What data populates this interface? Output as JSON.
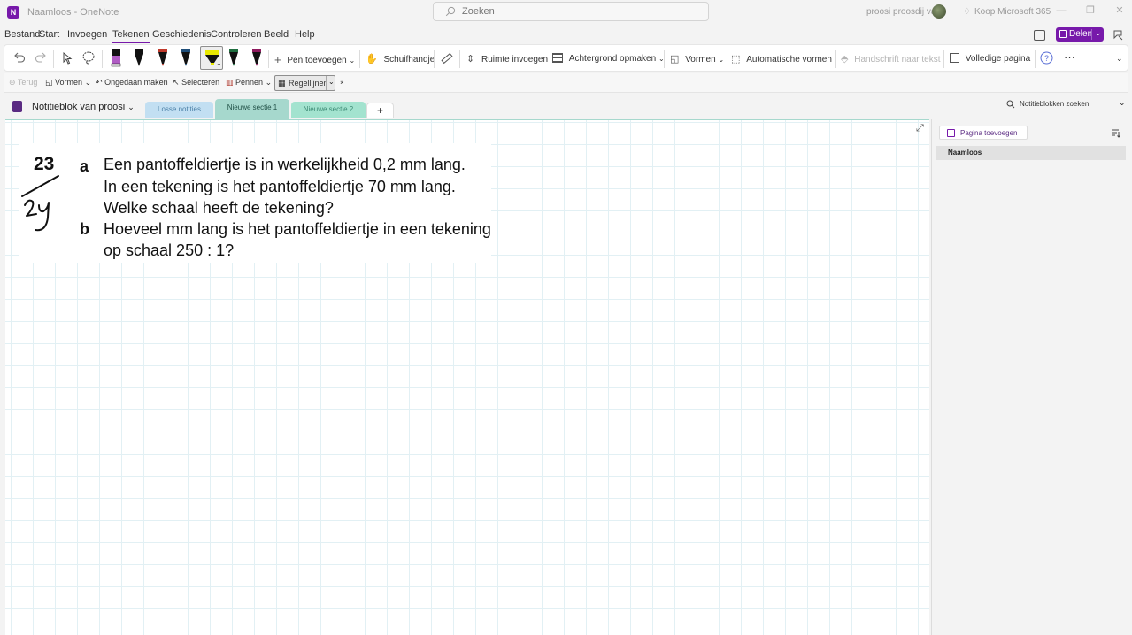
{
  "window": {
    "title": "Naamloos - OneNote",
    "search_placeholder": "Zoeken",
    "user_name": "proosi proosdij van",
    "buy_label": "Koop Microsoft 365",
    "controls": {
      "minimize": "—",
      "restore": "❐",
      "close": "✕"
    }
  },
  "menu": {
    "items": [
      "Bestand",
      "Start",
      "Invoegen",
      "Tekenen",
      "Geschiedenis",
      "Controleren",
      "Beeld",
      "Help"
    ],
    "active": "Tekenen",
    "share_label": "Delen"
  },
  "ribbon": {
    "pen_colors": [
      "#c0392b",
      "#111111",
      "#c0392b",
      "#1f4e79",
      "#e8e800",
      "#1f6e3f",
      "#8e1a5e"
    ],
    "add_pen_label": "Pen toevoegen",
    "hand_label": "Schuifhandje",
    "insert_space_label": "Ruimte invoegen",
    "background_label": "Achtergrond opmaken",
    "shapes_label": "Vormen",
    "auto_shapes_label": "Automatische vormen",
    "ink_to_text_label": "Handschrift naar tekst",
    "full_page_label": "Volledige pagina",
    "more_label": "···"
  },
  "toolbar2": {
    "back_label": "Terug",
    "shapes_label": "Vormen",
    "undo_label": "Ongedaan maken",
    "select_label": "Selecteren",
    "pens_label": "Pennen",
    "rule_lines_label": "Regellijnen"
  },
  "notebook": {
    "name": "Notitieblok van proosi",
    "sections": [
      {
        "label": "Losse notities",
        "color": "#c2dff2",
        "text_color": "#4a7fa6"
      },
      {
        "label": "Nieuwe sectie 1",
        "color": "#a6d8cd",
        "text_color": "#1e4e44"
      },
      {
        "label": "Nieuwe sectie 2",
        "color": "#a3e3cf",
        "text_color": "#3c8a74"
      }
    ],
    "add_section": "+",
    "search_label": "Notitieblokken zoeken"
  },
  "page": {
    "exercise_number": "23",
    "handwritten_note": "24",
    "part_a_letter": "a",
    "part_a_lines": [
      "Een pantoffeldiertje is in werkelijkheid 0,2 mm lang.",
      "In een tekening is het pantoffeldiertje 70 mm lang.",
      "Welke schaal heeft de tekening?"
    ],
    "part_b_letter": "b",
    "part_b_lines": [
      "Hoeveel mm lang is het pantoffeldiertje in een tekening",
      "op schaal 250 : 1?"
    ]
  },
  "pages_panel": {
    "add_page_label": "Pagina toevoegen",
    "pages": [
      "Naamloos"
    ]
  }
}
